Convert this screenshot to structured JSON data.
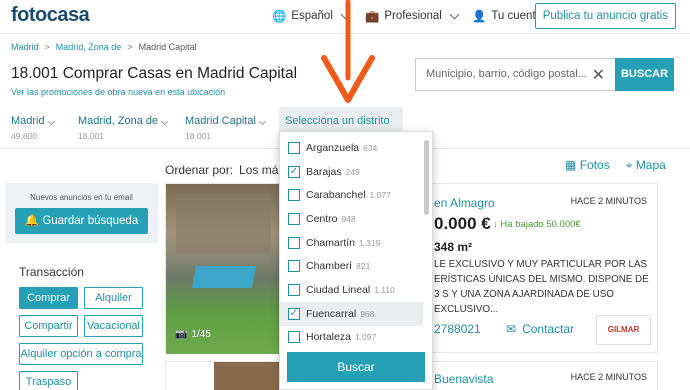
{
  "header": {
    "logo": "fotocasa",
    "language": "Español",
    "profile": "Profesional",
    "account": "Tu cuenta",
    "publish": "Publica tu anuncio gratis"
  },
  "breadcrumb": [
    "Madrid",
    "Madrid, Zona de",
    "Madrid Capital"
  ],
  "title": "18.001 Comprar Casas en Madrid Capital",
  "promo_link": "Ver las promociones de obra nueva en esta ubicación",
  "search": {
    "placeholder": "Municipio, barrio, código postal...",
    "button": "BUSCAR"
  },
  "location_filters": [
    {
      "label": "Madrid",
      "count": "49.800"
    },
    {
      "label": "Madrid, Zona de",
      "count": "18.001"
    },
    {
      "label": "Madrid Capital",
      "count": "18.001"
    }
  ],
  "district_select": "Selecciona un distrito",
  "order": {
    "label": "Ordenar por:",
    "value": "Los más"
  },
  "views": {
    "photos": "Fotos",
    "map": "Mapa"
  },
  "sidebar": {
    "note": "Nuevos anuncios en tu email",
    "save": "Guardar búsqueda",
    "transaction_title": "Transacción",
    "buttons": [
      "Comprar",
      "Alquiler",
      "Compartir",
      "Vacacional",
      "Alquiler opción a compra",
      "Traspaso"
    ]
  },
  "districts": [
    {
      "name": "Arganzuela",
      "count": "634",
      "checked": false
    },
    {
      "name": "Barajas",
      "count": "249",
      "checked": true
    },
    {
      "name": "Carabanchel",
      "count": "1.077",
      "checked": false
    },
    {
      "name": "Centro",
      "count": "948",
      "checked": false
    },
    {
      "name": "Chamartín",
      "count": "1.319",
      "checked": false
    },
    {
      "name": "Chamberí",
      "count": "821",
      "checked": false
    },
    {
      "name": "Ciudad Lineal",
      "count": "1.110",
      "checked": false
    },
    {
      "name": "Fuencarral",
      "count": "968",
      "checked": true
    },
    {
      "name": "Hortaleza",
      "count": "1.097",
      "checked": false
    }
  ],
  "dropdown_button": "Buscar",
  "listing1": {
    "location": "en Almagro",
    "time": "HACE 2 MINUTOS",
    "price": "0.000 €",
    "price_drop": "Ha bajado 50.000€",
    "size": "348 m²",
    "description": "LE EXCLUSIVO Y MUY PARTICULAR POR LAS ERÍSTICAS ÚNICAS DEL MISMO. DISPONE DE 3 S Y UNA ZONA AJARDINADA DE USO EXCLUSIVO...",
    "phone": "2788021",
    "contact": "Contactar",
    "photos": "1/45",
    "agency": "GILMAR"
  },
  "listing2": {
    "location": "Buenavista",
    "time": "HACE 2 MINUTOS"
  }
}
